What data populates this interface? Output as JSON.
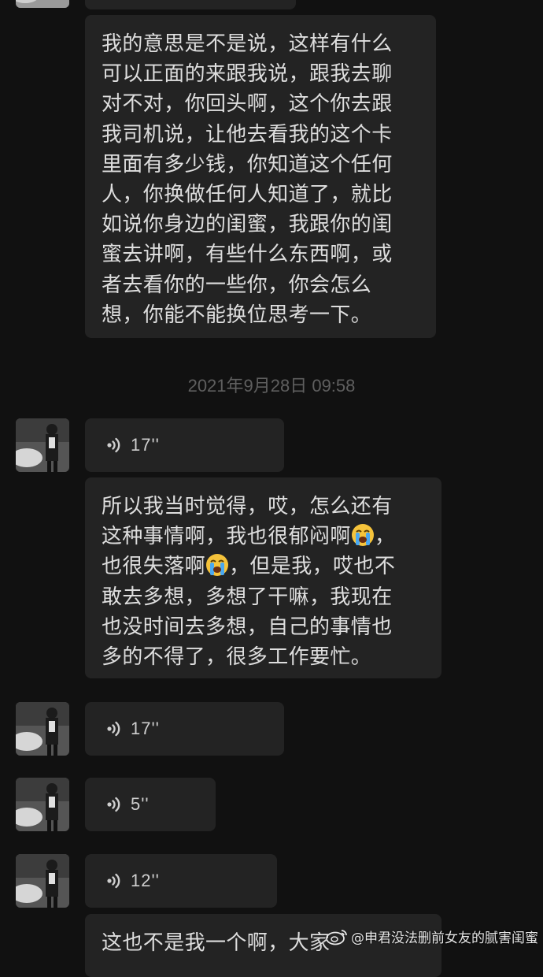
{
  "messages": {
    "msg1": {
      "lines": [
        "我的意思是不是说，这样有什么",
        "可以正面的来跟我说，跟我去聊",
        "对不对，你回头啊，这个你去跟",
        "我司机说，让他去看我的这个卡",
        "里面有多少钱，你知道这个任何",
        "人，你换做任何人知道了，就比",
        "如说你身边的闺蜜，我跟你的闺",
        "蜜去讲啊，有些什么东西啊，或",
        "者去看你的一些你，你会怎么",
        "想，你能不能换位思考一下。"
      ]
    },
    "timestamp": "2021年9月28日 09:58",
    "voice1": {
      "duration": "17''"
    },
    "msg2": {
      "line1": "所以我当时觉得，哎，怎么还有",
      "line2a": "这种事情啊，我也很郁闷啊",
      "line2b": "，",
      "line3a": "也很失落啊",
      "line3b": "，但是我，哎也不",
      "line4": "敢去多想，多想了干嘛，我现在",
      "line5": "也没时间去多想，自己的事情也",
      "line6": "多的不得了，很多工作要忙。",
      "emoji": "loudly-crying-face"
    },
    "voice2": {
      "duration": "17''"
    },
    "voice3": {
      "duration": "5''"
    },
    "voice4": {
      "duration": "12''"
    },
    "msg3_partial": "这也不是我一个啊，大家"
  },
  "watermark": {
    "text": "@申君没法删前女友的腻害闺蜜",
    "logo": "weibo-logo"
  },
  "colors": {
    "background": "#111111",
    "bubble": "#232323",
    "text": "#dedede",
    "timestamp": "#5f5f5f"
  }
}
